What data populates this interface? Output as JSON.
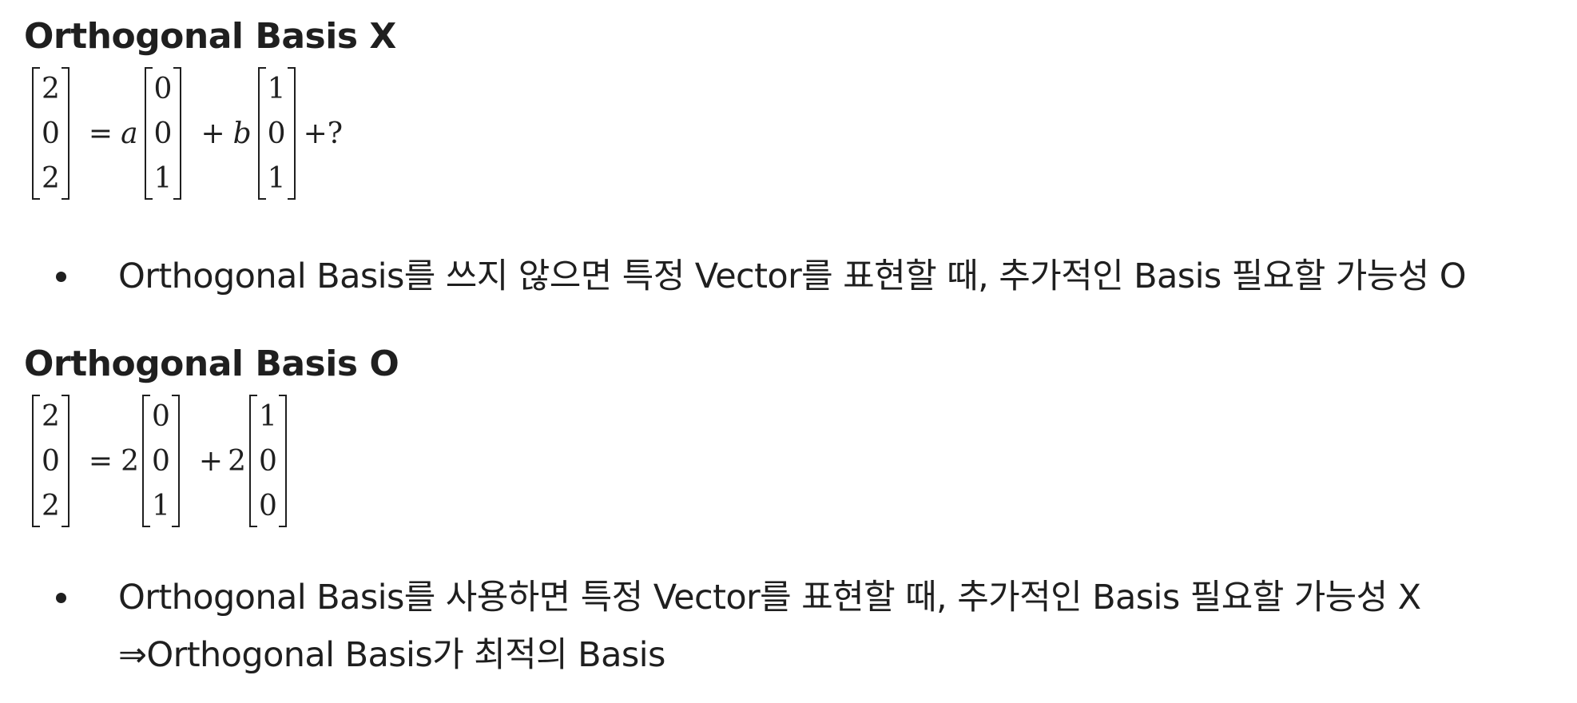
{
  "section_x": {
    "heading": "Orthogonal Basis X",
    "lhs": [
      "2",
      "0",
      "2"
    ],
    "eq_sign": "=",
    "coef1": "a",
    "vec1": [
      "0",
      "0",
      "1"
    ],
    "plus1": "+",
    "coef2": "b",
    "vec2": [
      "1",
      "0",
      "1"
    ],
    "tail": "+?",
    "bullet": "Orthogonal Basis를 쓰지 않으면 특정 Vector를 표현할 때, 추가적인 Basis 필요할 가능성 O"
  },
  "section_o": {
    "heading": "Orthogonal Basis O",
    "lhs": [
      "2",
      "0",
      "2"
    ],
    "eq_sign": "=",
    "coef1": "2",
    "vec1": [
      "0",
      "0",
      "1"
    ],
    "plus1": "+",
    "coef2": "2",
    "vec2": [
      "1",
      "0",
      "0"
    ],
    "bullet_line1": "Orthogonal Basis를 사용하면 특정 Vector를 표현할 때, 추가적인 Basis 필요할 가능성 X",
    "bullet_line2": "⇒Orthogonal Basis가 최적의 Basis"
  }
}
